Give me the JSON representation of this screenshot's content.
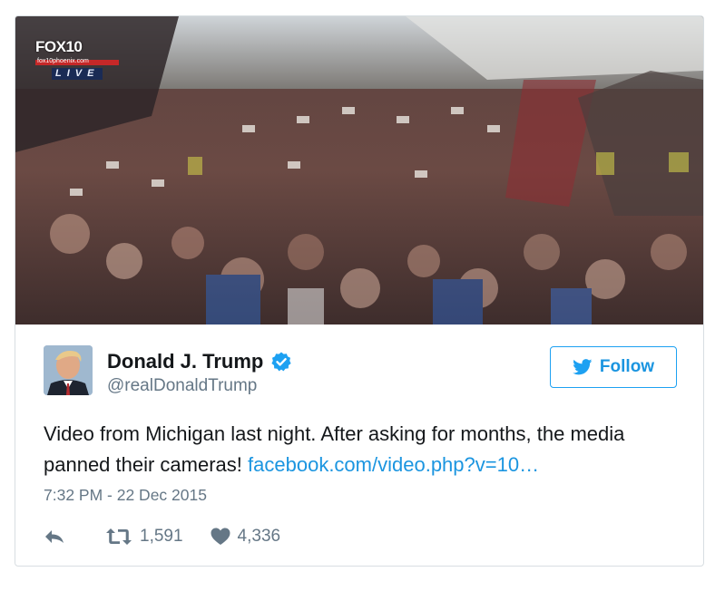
{
  "media": {
    "channel": "FOX10",
    "channel_url": "fox10phoenix.com",
    "live_label": "LIVE"
  },
  "user": {
    "display_name": "Donald J. Trump",
    "handle": "@realDonaldTrump",
    "verified": true
  },
  "follow_button": {
    "label": "Follow"
  },
  "tweet": {
    "text": "Video from Michigan last night. After asking for months, the media panned their cameras! ",
    "link_text": "facebook.com/video.php?v=10…",
    "timestamp": "7:32 PM - 22 Dec 2015"
  },
  "actions": {
    "retweets": "1,591",
    "likes": "4,336"
  },
  "colors": {
    "accent": "#1da1f2",
    "link": "#1b95e0",
    "muted": "#657786",
    "text": "#14171a",
    "border": "#d8dee2"
  },
  "icons": {
    "reply": "reply-icon",
    "retweet": "retweet-icon",
    "like": "heart-icon",
    "verified": "verified-badge-icon",
    "follow": "twitter-bird-icon"
  }
}
